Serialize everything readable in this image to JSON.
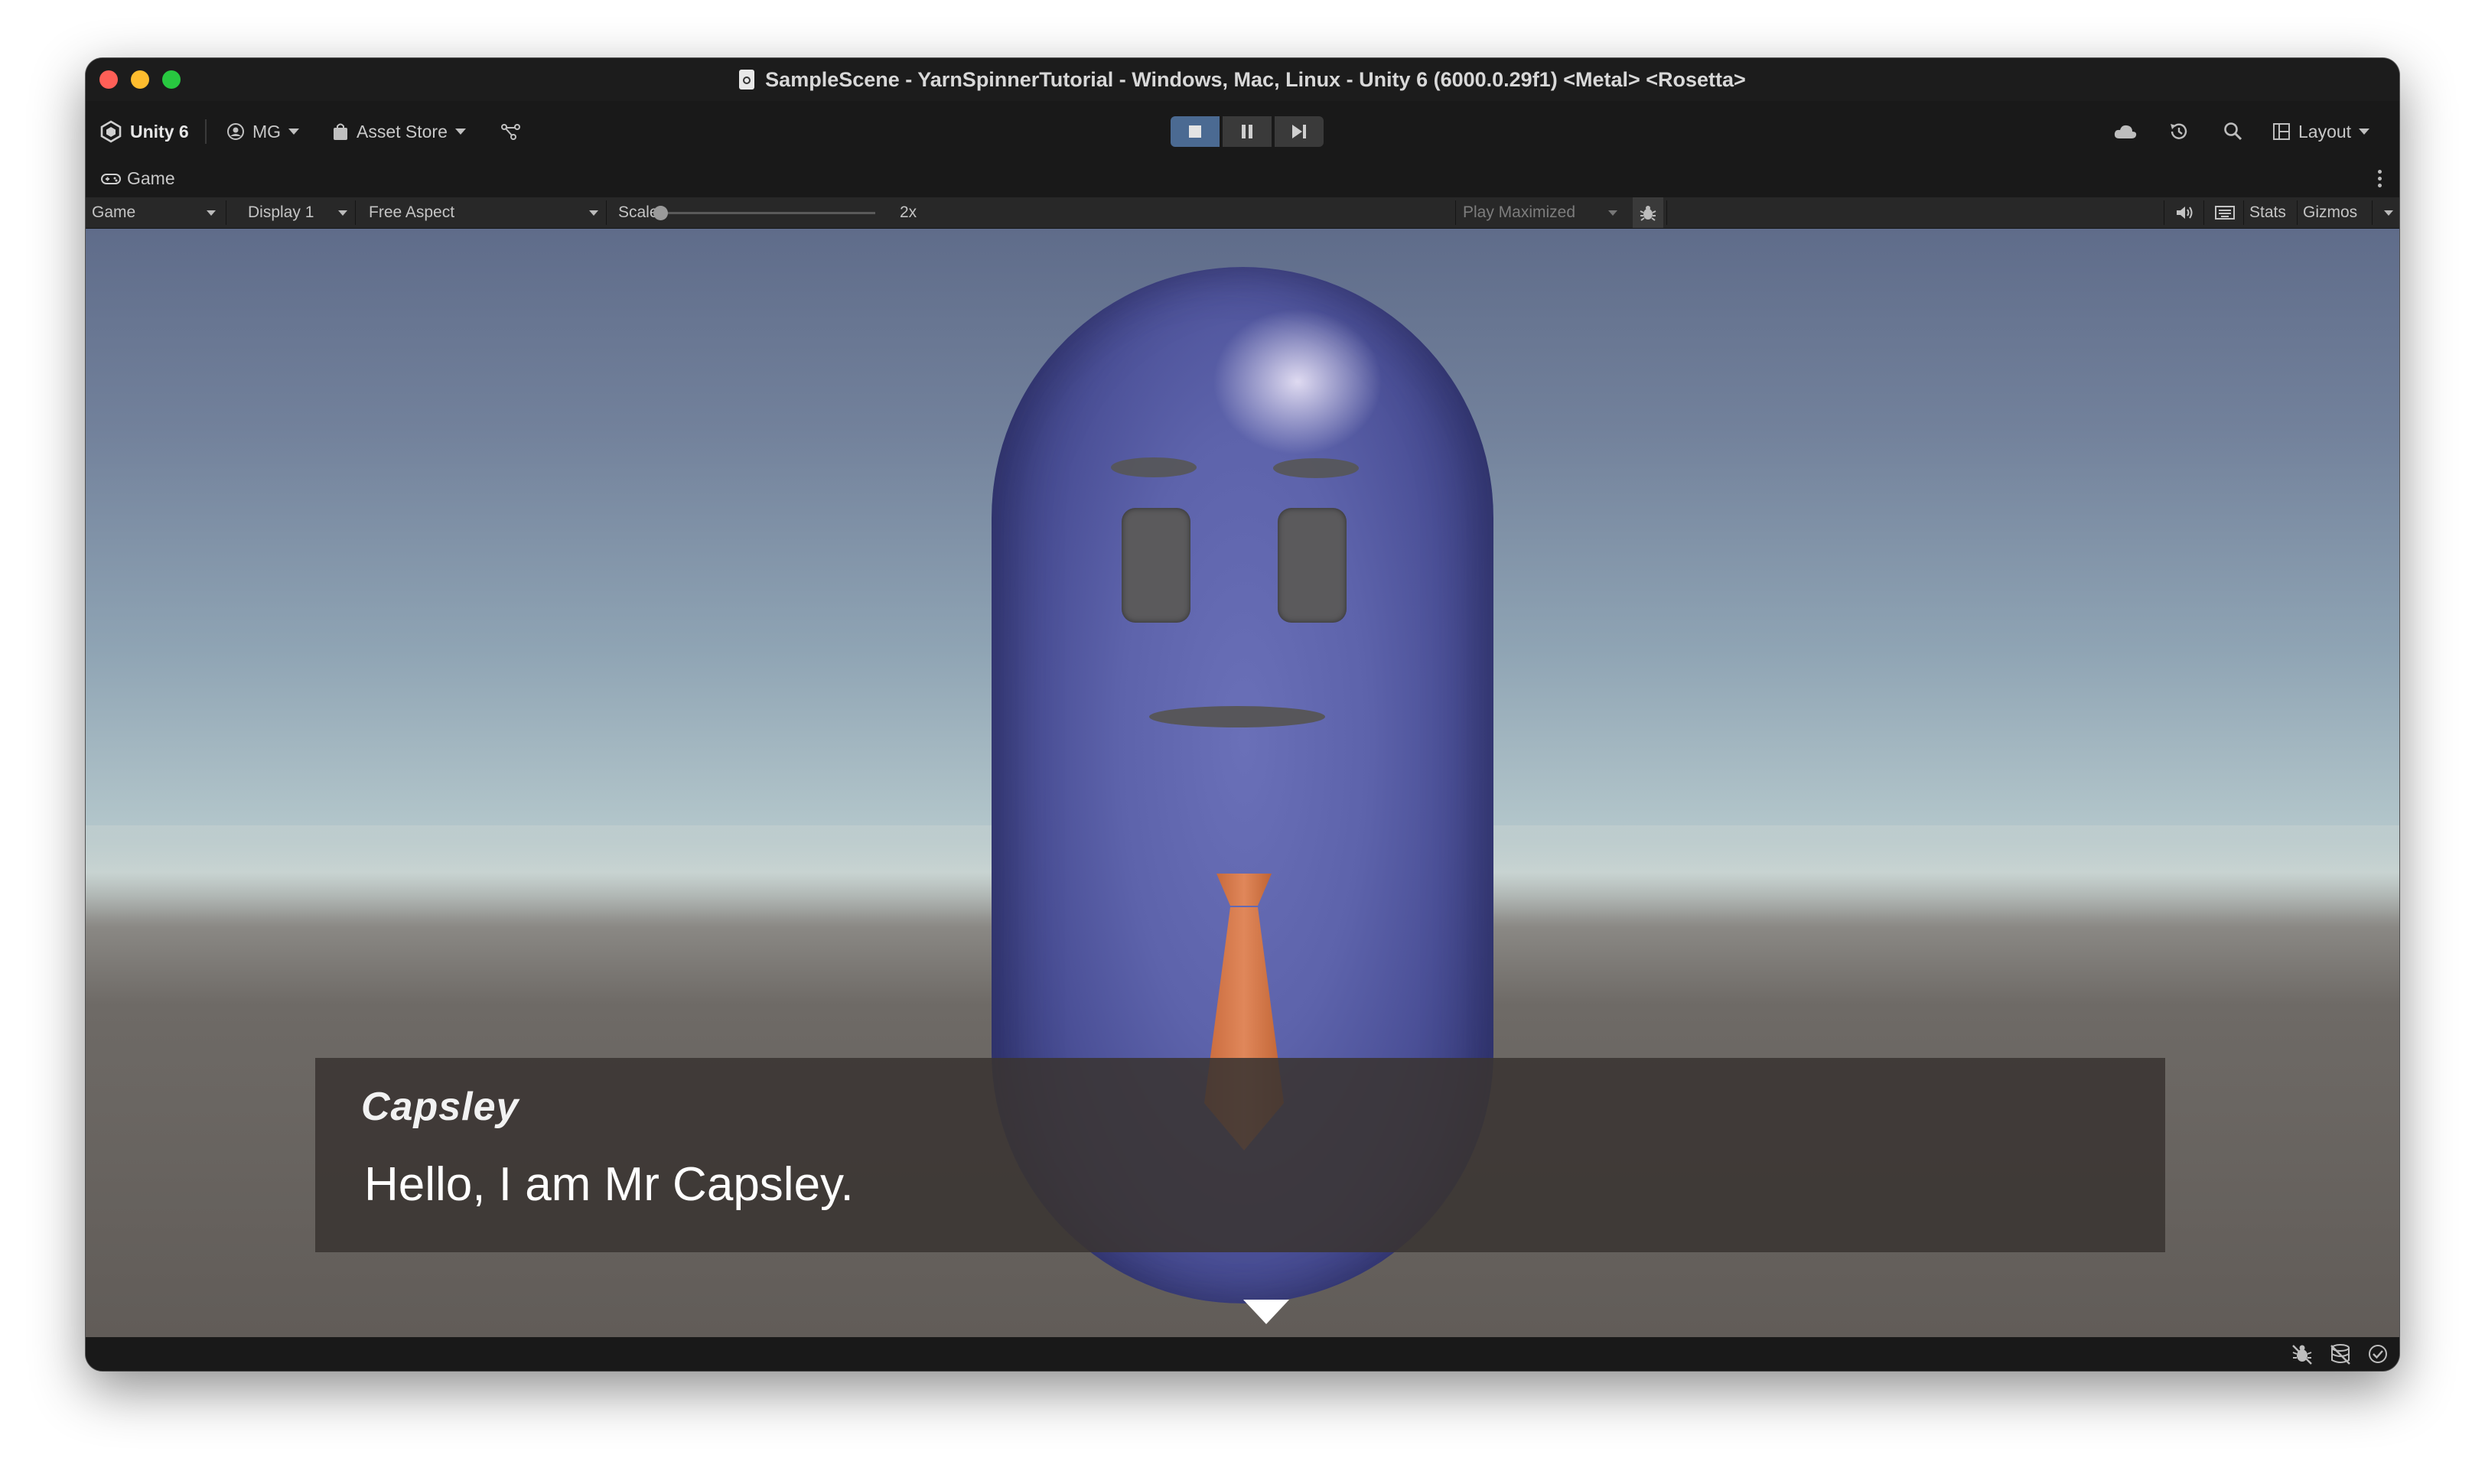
{
  "window": {
    "title": "SampleScene - YarnSpinnerTutorial - Windows, Mac, Linux - Unity 6 (6000.0.29f1) <Metal> <Rosetta>"
  },
  "toolbar": {
    "unity_label": "Unity 6",
    "account_label": "MG",
    "asset_store_label": "Asset Store",
    "layout_label": "Layout"
  },
  "tab": {
    "label": "Game"
  },
  "game_toolbar": {
    "mode": "Game",
    "display": "Display 1",
    "aspect": "Free Aspect",
    "scale_label": "Scale",
    "scale_value": "2x",
    "play_mode": "Play Maximized",
    "stats_label": "Stats",
    "gizmos_label": "Gizmos"
  },
  "dialogue": {
    "speaker": "Capsley",
    "line": "Hello, I am Mr Capsley."
  },
  "colors": {
    "play_active": "#4b6a92",
    "capsule": "#5d63ab",
    "tie": "#d87b4a",
    "dialogue_bg": "#3a3432"
  }
}
